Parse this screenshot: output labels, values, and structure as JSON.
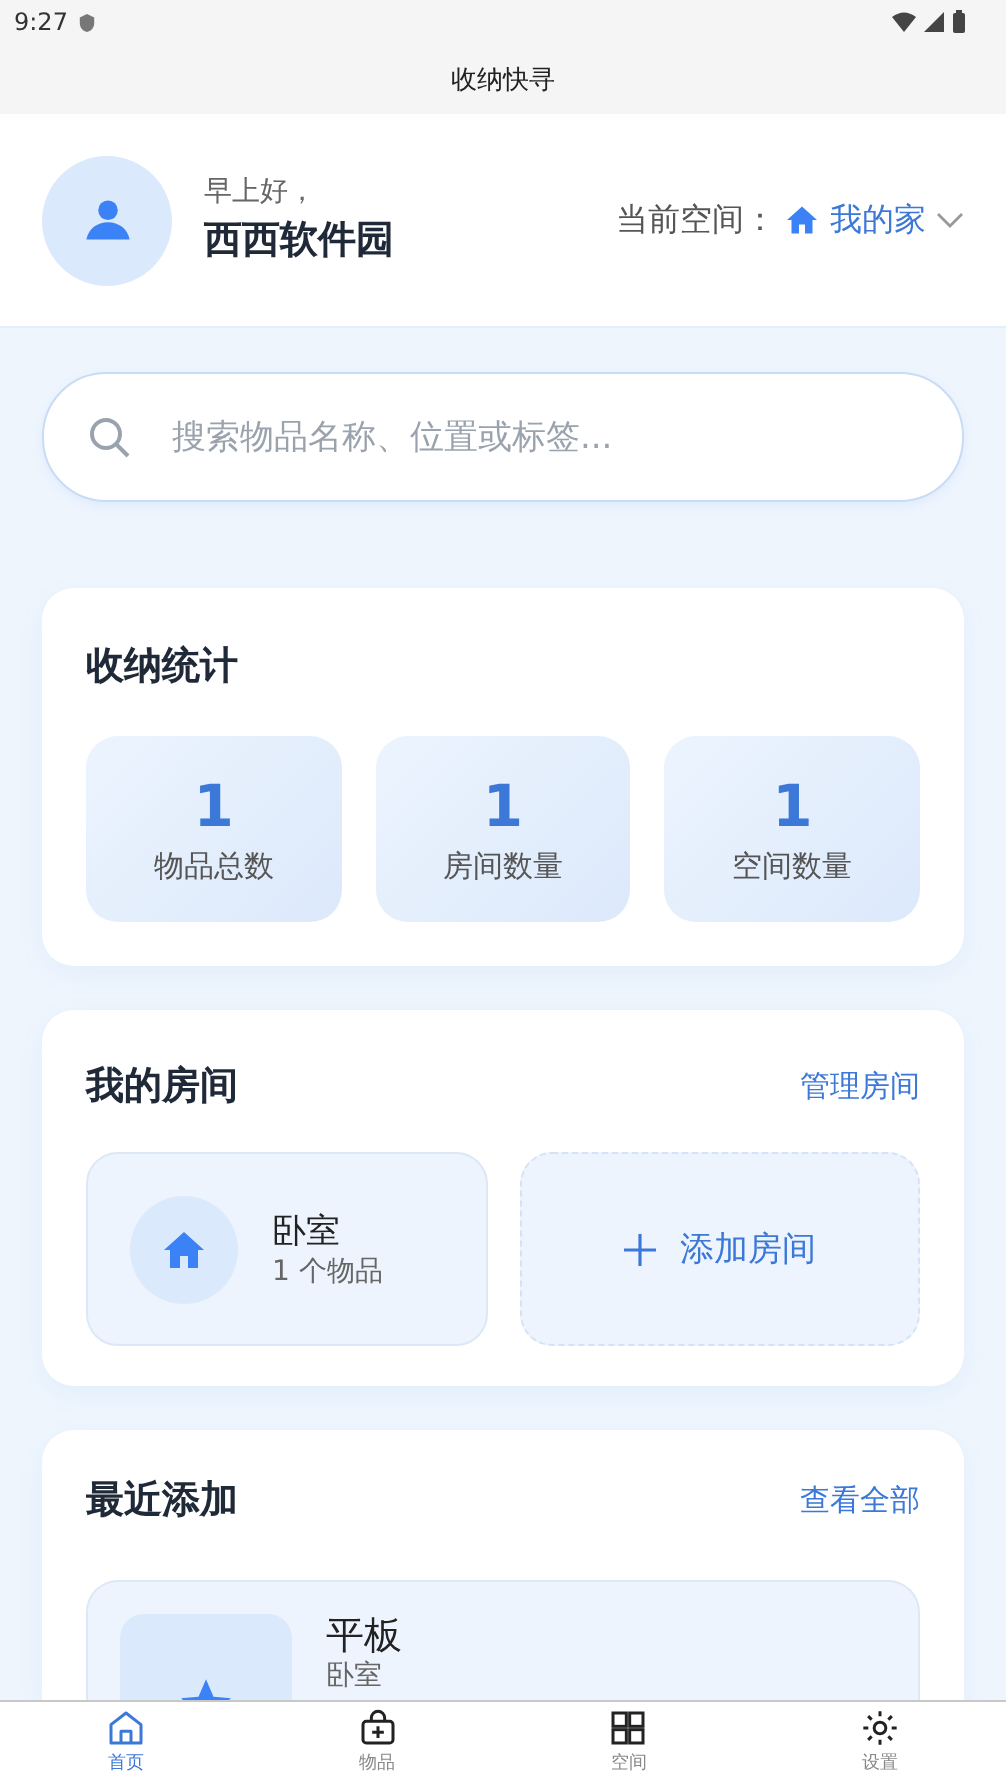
{
  "status_bar": {
    "time": "9:27"
  },
  "app_bar": {
    "title": "收纳快寻"
  },
  "header": {
    "greeting": "早上好，",
    "user_name": "西西软件园",
    "space_label": "当前空间：",
    "space_name": "我的家"
  },
  "search": {
    "placeholder": "搜索物品名称、位置或标签..."
  },
  "stats": {
    "title": "收纳统计",
    "items": [
      {
        "value": "1",
        "label": "物品总数"
      },
      {
        "value": "1",
        "label": "房间数量"
      },
      {
        "value": "1",
        "label": "空间数量"
      }
    ]
  },
  "rooms": {
    "title": "我的房间",
    "action": "管理房间",
    "items": [
      {
        "name": "卧室",
        "count": "1 个物品"
      }
    ],
    "add_label": "添加房间"
  },
  "recent": {
    "title": "最近添加",
    "action": "查看全部",
    "items": [
      {
        "name": "平板",
        "room": "卧室"
      }
    ]
  },
  "bottom_nav": [
    {
      "label": "首页",
      "kind": "home",
      "selected": true
    },
    {
      "label": "物品",
      "kind": "items",
      "selected": false
    },
    {
      "label": "空间",
      "kind": "spaces",
      "selected": false
    },
    {
      "label": "设置",
      "kind": "settings",
      "selected": false
    }
  ]
}
